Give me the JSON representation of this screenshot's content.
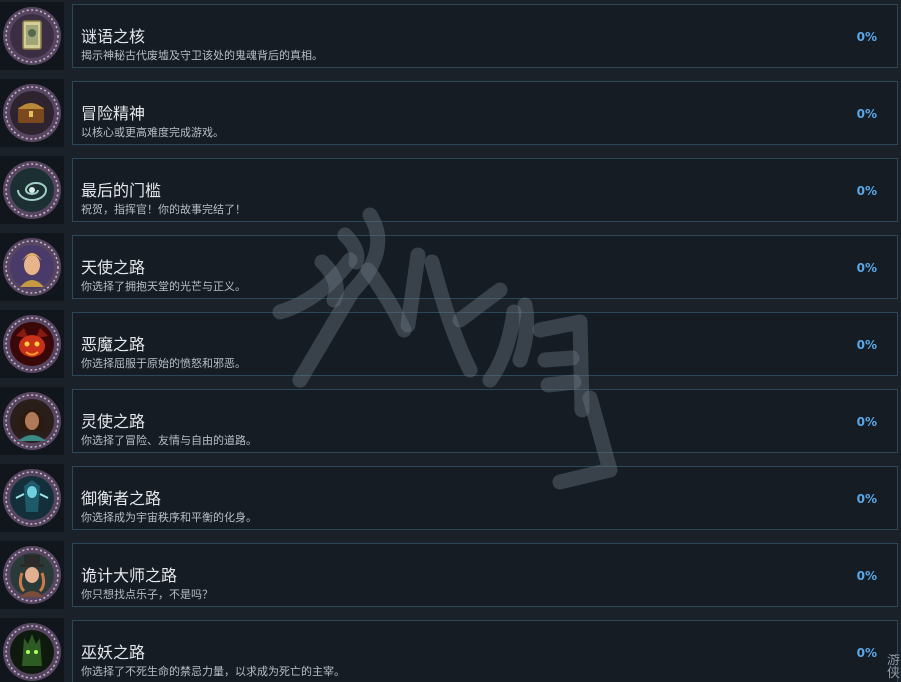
{
  "achievements": [
    {
      "title": "谜语之核",
      "desc": "揭示神秘古代废墟及守卫该处的鬼魂背后的真相。",
      "progress": "0%",
      "icon": "riddle-card-icon",
      "colors": [
        "#c9bf86",
        "#6c6a48"
      ]
    },
    {
      "title": "冒险精神",
      "desc": "以核心或更高难度完成游戏。",
      "progress": "0%",
      "icon": "treasure-chest-icon",
      "colors": [
        "#b98838",
        "#5a3a1a"
      ]
    },
    {
      "title": "最后的门槛",
      "desc": "祝贺，指挥官！你的故事完结了！",
      "progress": "0%",
      "icon": "portal-vortex-icon",
      "colors": [
        "#7fb5b0",
        "#1c2f33"
      ]
    },
    {
      "title": "天使之路",
      "desc": "你选择了拥抱天堂的光芒与正义。",
      "progress": "0%",
      "icon": "angel-hero-icon",
      "colors": [
        "#e3b35e",
        "#6a4a8a"
      ]
    },
    {
      "title": "恶魔之路",
      "desc": "你选择屈服于原始的愤怒和邪恶。",
      "progress": "0%",
      "icon": "demon-face-icon",
      "colors": [
        "#d83a1e",
        "#4a0a0a"
      ]
    },
    {
      "title": "灵使之路",
      "desc": "你选择了冒险、友情与自由的道路。",
      "progress": "0%",
      "icon": "spirit-envoy-icon",
      "colors": [
        "#5fb0a8",
        "#2a1e1a"
      ]
    },
    {
      "title": "御衡者之路",
      "desc": "你选择成为宇宙秩序和平衡的化身。",
      "progress": "0%",
      "icon": "balance-keeper-icon",
      "colors": [
        "#6fd0e0",
        "#13303a"
      ]
    },
    {
      "title": "诡计大师之路",
      "desc": "你只想找点乐子，不是吗？",
      "progress": "0%",
      "icon": "trickster-icon",
      "colors": [
        "#c98a5a",
        "#2a3a38"
      ]
    },
    {
      "title": "巫妖之路",
      "desc": "你选择了不死生命的禁忌力量，以求成为死亡的主宰。",
      "progress": "0%",
      "icon": "lich-icon",
      "colors": [
        "#5a9a3a",
        "#0e1a0e"
      ]
    }
  ],
  "watermark": {
    "text": "游侠网",
    "corner_text": "游侠"
  }
}
